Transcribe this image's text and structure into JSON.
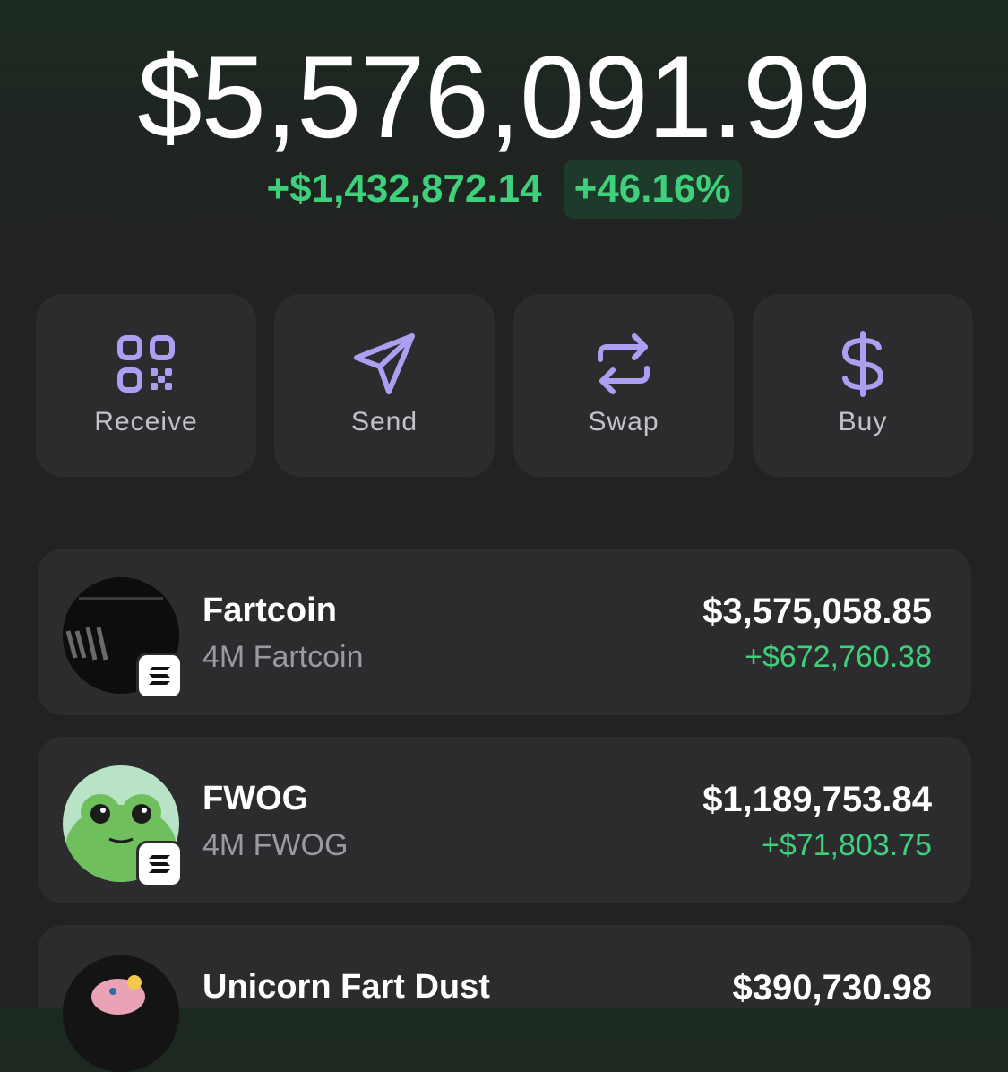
{
  "portfolio": {
    "balance": "$5,576,091.99",
    "change_amount": "+$1,432,872.14",
    "change_percent": "+46.16%"
  },
  "actions": [
    {
      "label": "Receive",
      "icon": "qr-code-icon"
    },
    {
      "label": "Send",
      "icon": "send-icon"
    },
    {
      "label": "Swap",
      "icon": "swap-icon"
    },
    {
      "label": "Buy",
      "icon": "dollar-icon"
    }
  ],
  "tokens": [
    {
      "name": "Fartcoin",
      "holding": "4M Fartcoin",
      "value": "$3,575,058.85",
      "change": "+$672,760.38",
      "chain_icon": "solana-icon"
    },
    {
      "name": "FWOG",
      "holding": "4M FWOG",
      "value": "$1,189,753.84",
      "change": "+$71,803.75",
      "chain_icon": "solana-icon"
    },
    {
      "name": "Unicorn Fart Dust",
      "value": "$390,730.98"
    }
  ],
  "colors": {
    "accent": "#ab9ff2",
    "positive": "#3ed07b",
    "card": "#2c2c2f",
    "background": "#222222"
  }
}
